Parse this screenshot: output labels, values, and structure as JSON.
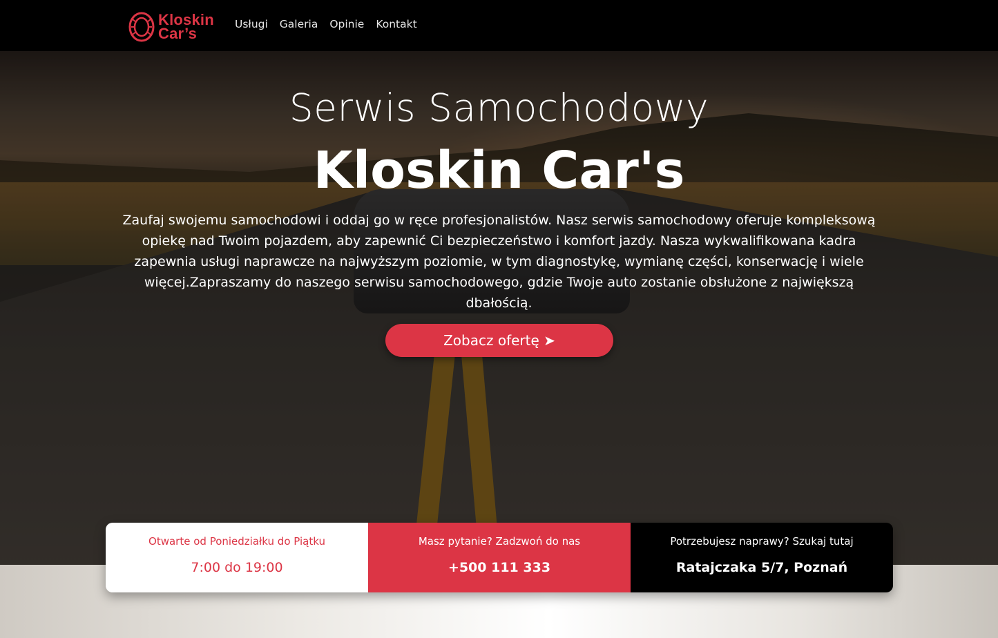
{
  "brand": {
    "line1": "Kloskin",
    "line2": "Car’s",
    "color": "#dc3545"
  },
  "nav": {
    "items": [
      "Usługi",
      "Galeria",
      "Opinie",
      "Kontakt"
    ]
  },
  "hero": {
    "subtitle": "Serwis Samochodowy",
    "title": "Kloskin Car's",
    "description": "Zaufaj swojemu samochodowi i oddaj go w ręce profesjonalistów. Nasz serwis samochodowy oferuje kompleksową opiekę nad Twoim pojazdem, aby zapewnić Ci bezpieczeństwo i komfort jazdy. Nasza wykwalifikowana kadra zapewnia usługi naprawcze na najwyższym poziomie, w tym diagnostykę, wymianę części, konserwację i wiele więcej.Zapraszamy do naszego serwisu samochodowego, gdzie Twoje auto zostanie obsłużone z największą dbałością.",
    "cta": "Zobacz ofertę ➤"
  },
  "info": {
    "hours": {
      "label": "Otwarte od Poniedziałku do Piątku",
      "value": "7:00 do 19:00"
    },
    "phone": {
      "label": "Masz pytanie? Zadzwoń do nas",
      "value": "+500 111 333"
    },
    "address": {
      "label": "Potrzebujesz naprawy? Szukaj tutaj",
      "value": "Ratajczaka 5/7, Poznań"
    }
  }
}
